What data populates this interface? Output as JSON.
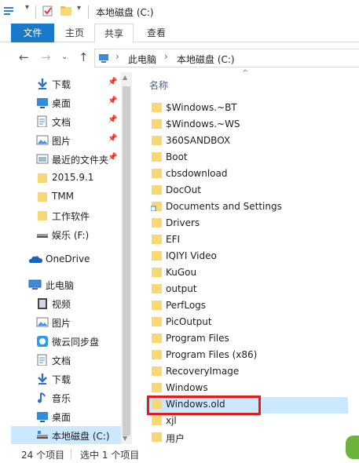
{
  "window": {
    "title": "本地磁盘 (C:)"
  },
  "ribbon": {
    "tabs": [
      {
        "label": "文件",
        "active": true
      },
      {
        "label": "主页"
      },
      {
        "label": "共享"
      },
      {
        "label": "查看"
      }
    ]
  },
  "address": {
    "crumbs": [
      "此电脑",
      "本地磁盘 (C:)"
    ]
  },
  "nav_pane": {
    "items": [
      {
        "label": "下载",
        "icon": "download-icon",
        "pinned": true
      },
      {
        "label": "桌面",
        "icon": "desktop-icon",
        "pinned": true
      },
      {
        "label": "文档",
        "icon": "document-icon",
        "pinned": true
      },
      {
        "label": "图片",
        "icon": "picture-icon",
        "pinned": true
      },
      {
        "label": "最近的文件夹",
        "icon": "recent-folders-icon",
        "pinned": true
      },
      {
        "label": "2015.9.1",
        "icon": "folder-icon"
      },
      {
        "label": "TMM",
        "icon": "folder-icon"
      },
      {
        "label": "工作软件",
        "icon": "folder-icon"
      },
      {
        "label": "娱乐 (F:)",
        "icon": "drive-icon"
      },
      {
        "label": "OneDrive",
        "icon": "onedrive-icon"
      },
      {
        "label": "此电脑",
        "icon": "this-pc-icon"
      },
      {
        "label": "视频",
        "icon": "video-icon"
      },
      {
        "label": "图片",
        "icon": "picture-icon"
      },
      {
        "label": "微云同步盘",
        "icon": "weiyun-icon"
      },
      {
        "label": "文档",
        "icon": "document-icon"
      },
      {
        "label": "下载",
        "icon": "download-icon"
      },
      {
        "label": "音乐",
        "icon": "music-icon"
      },
      {
        "label": "桌面",
        "icon": "desktop-icon"
      },
      {
        "label": "本地磁盘 (C:)",
        "icon": "drive-icon",
        "selected": true
      }
    ]
  },
  "file_list": {
    "column_name": "名称",
    "items": [
      "$Windows.~BT",
      "$Windows.~WS",
      "360SANDBOX",
      "Boot",
      "cbsdownload",
      "DocOut",
      "Documents and Settings",
      "Drivers",
      "EFI",
      "IQIYI Video",
      "KuGou",
      "output",
      "PerfLogs",
      "PicOutput",
      "Program Files",
      "Program Files (x86)",
      "RecoveryImage",
      "Windows",
      "Windows.old",
      "xjl",
      "用户"
    ],
    "selected": "Windows.old"
  },
  "status": {
    "count": "24 个项目",
    "selection": "选中 1 个项目"
  },
  "colors": {
    "accent": "#1979ca",
    "selection": "#cce8ff",
    "folder": "#f8d775",
    "highlight": "#e31b1b"
  }
}
